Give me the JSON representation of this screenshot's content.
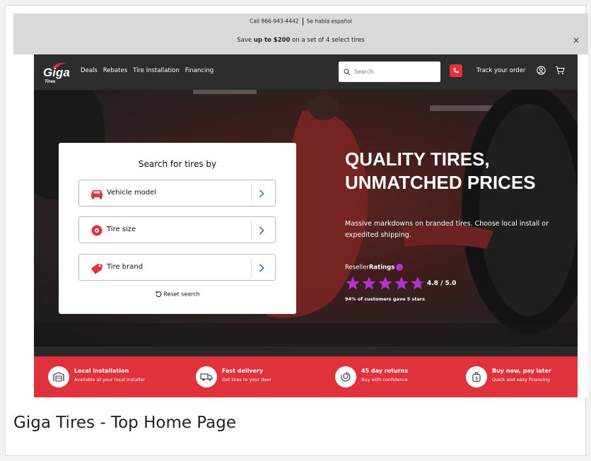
{
  "topbar": {
    "phone_text": "Call 866-943-4442",
    "spanish_text": "Se habla español",
    "promo_prefix": "Save ",
    "promo_bold": "up to $200",
    "promo_suffix": " on a set of 4 select tires",
    "close_icon": "×"
  },
  "nav": {
    "logo_text": "Giga",
    "logo_sub": "Tires",
    "links": [
      "Deals",
      "Rebates",
      "Tire Installation",
      "Financing"
    ],
    "search_placeholder": "Search",
    "track_label": "Track your order"
  },
  "search_card": {
    "title": "Search for tires by",
    "options": [
      {
        "label": "Vehicle model",
        "icon": "car-icon"
      },
      {
        "label": "Tire size",
        "icon": "tire-icon"
      },
      {
        "label": "Tire brand",
        "icon": "tag-icon"
      }
    ],
    "reset_label": "Reset search"
  },
  "hero": {
    "title_line1": "QUALITY TIRES,",
    "title_line2": "UNMATCHED PRICES",
    "subtitle": "Massive markdowns on branded tires. Choose local install or expedited shipping.",
    "reseller_prefix": "Reseller",
    "reseller_bold": "Ratings",
    "rating": "4.8 / 5.0",
    "rating_value": 4.8,
    "rating_note": "94% of customers gave 5 stars"
  },
  "features": [
    {
      "title": "Local installation",
      "subtitle": "Available at your local installer",
      "icon": "garage-icon"
    },
    {
      "title": "Fast delivery",
      "subtitle": "Get tires to your door",
      "icon": "truck-icon"
    },
    {
      "title": "45 day returns",
      "subtitle": "Buy with confidence",
      "icon": "return-box-icon"
    },
    {
      "title": "Buy now, pay later",
      "subtitle": "Quick and easy financing",
      "icon": "money-bag-icon"
    }
  ],
  "colors": {
    "brand_red": "#e0323c",
    "nav_dark": "#2d2d2d",
    "star_purple": "#b62fcf"
  },
  "caption": "Giga Tires - Top Home Page"
}
